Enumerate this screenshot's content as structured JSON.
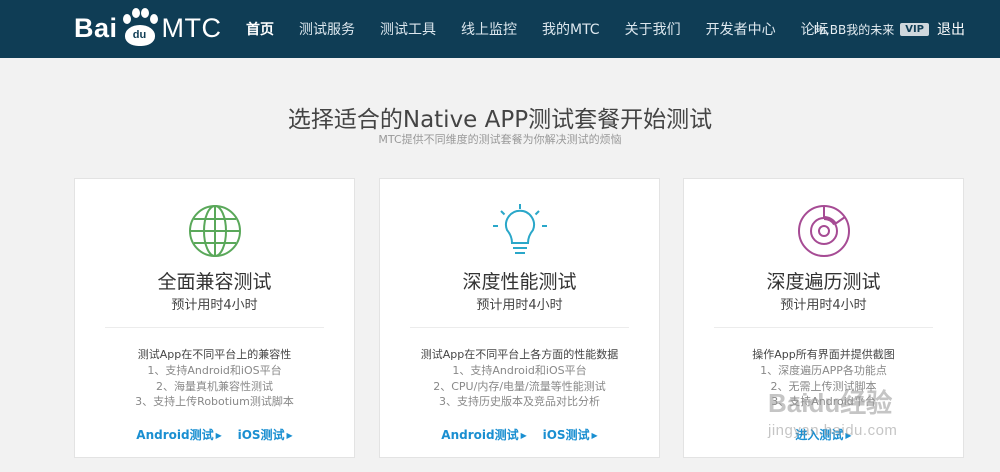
{
  "header": {
    "logo": {
      "bai": "Bai",
      "du": "du",
      "mtc": "MTC"
    },
    "nav": [
      {
        "label": "首页",
        "active": true
      },
      {
        "label": "测试服务"
      },
      {
        "label": "测试工具"
      },
      {
        "label": "线上监控"
      },
      {
        "label": "我的MTC"
      },
      {
        "label": "关于我们"
      },
      {
        "label": "开发者中心"
      },
      {
        "label": "论坛"
      }
    ],
    "user": {
      "greeting": "Hi,BB我的未来",
      "vip": "VIP",
      "logout": "退出"
    }
  },
  "main": {
    "headline": "选择适合的Native APP测试套餐开始测试",
    "subline": "MTC提供不同维度的测试套餐为你解决测试的烦恼"
  },
  "cards": [
    {
      "icon": "globe-icon",
      "icon_color": "#5aa85a",
      "title": "全面兼容测试",
      "duration": "预计用时4小时",
      "desc": "测试App在不同平台上的兼容性",
      "features": [
        "1、支持Android和iOS平台",
        "2、海量真机兼容性测试",
        "3、支持上传Robotium测试脚本"
      ],
      "links": [
        "Android测试",
        "iOS测试"
      ]
    },
    {
      "icon": "lightbulb-icon",
      "icon_color": "#2aa7c9",
      "title": "深度性能测试",
      "duration": "预计用时4小时",
      "desc": "测试App在不同平台上各方面的性能数据",
      "features": [
        "1、支持Android和iOS平台",
        "2、CPU/内存/电量/流量等性能测试",
        "3、支持历史版本及竞品对比分析"
      ],
      "links": [
        "Android测试",
        "iOS测试"
      ]
    },
    {
      "icon": "traversal-chart-icon",
      "icon_color": "#a64b94",
      "title": "深度遍历测试",
      "duration": "预计用时4小时",
      "desc": "操作App所有界面并提供截图",
      "features": [
        "1、深度遍历APP各功能点",
        "2、无需上传测试脚本",
        "3、支持Android平台"
      ],
      "links": [
        "进入测试"
      ]
    }
  ],
  "watermark": {
    "logo": "Baidu经验",
    "url": "jingyan.baidu.com"
  },
  "colors": {
    "header_bg": "#0f3d55",
    "link": "#1a8fd1",
    "page_bg": "#f2f2f2"
  }
}
